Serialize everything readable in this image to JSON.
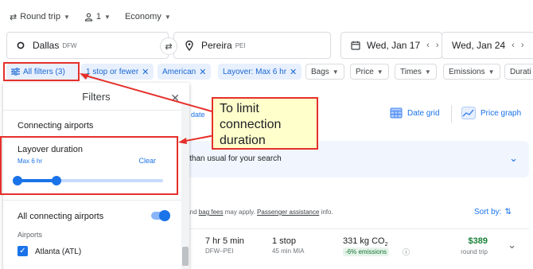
{
  "topbar": {
    "trip_type": "Round trip",
    "passengers": "1",
    "cabin": "Economy"
  },
  "search": {
    "origin": "Dallas",
    "origin_code": "DFW",
    "destination": "Pereira",
    "destination_code": "PEI",
    "depart_date": "Wed, Jan 17",
    "return_date": "Wed, Jan 24"
  },
  "chips": {
    "all_filters": "All filters (3)",
    "stops": "1 stop or fewer",
    "airline": "American",
    "layover": "Layover: Max 6 hr",
    "bags": "Bags",
    "price": "Price",
    "times": "Times",
    "emissions": "Emissions",
    "duration": "Durati"
  },
  "filters_panel": {
    "title": "Filters",
    "section_connecting": "Connecting airports",
    "layover_label": "Layover duration",
    "layover_value": "Max 6 hr",
    "layover_clear": "Clear",
    "layover_slider_fraction": 0.27,
    "all_connecting_label": "All connecting airports",
    "all_connecting_on": true,
    "airports_label": "Airports",
    "airport_item": "Atlanta (ATL)"
  },
  "results": {
    "any_dates_partial": "ny date",
    "date_grid": "Date grid",
    "price_graph": "Price graph",
    "banner_text": "r than usual for your search",
    "fees_prefix": "s and ",
    "bag_fees": "bag fees",
    "fees_middle": " may apply. ",
    "passenger_assistance": "Passenger assistance",
    "fees_suffix": " info.",
    "sort_by": "Sort by:",
    "flight": {
      "duration": "7 hr 5 min",
      "route": "DFW–PEI",
      "stops": "1 stop",
      "layover": "45 min MIA",
      "co2": "331 kg CO",
      "co2_sub": "2",
      "emissions_badge": "-6% emissions",
      "price": "$389",
      "price_note": "round trip"
    }
  },
  "annotation": {
    "callout_text": "To limit connection duration"
  },
  "colors": {
    "accent": "#1a73e8",
    "annotation_red": "#e5302a",
    "callout_bg": "#ffffcc",
    "price_green": "#188038"
  }
}
